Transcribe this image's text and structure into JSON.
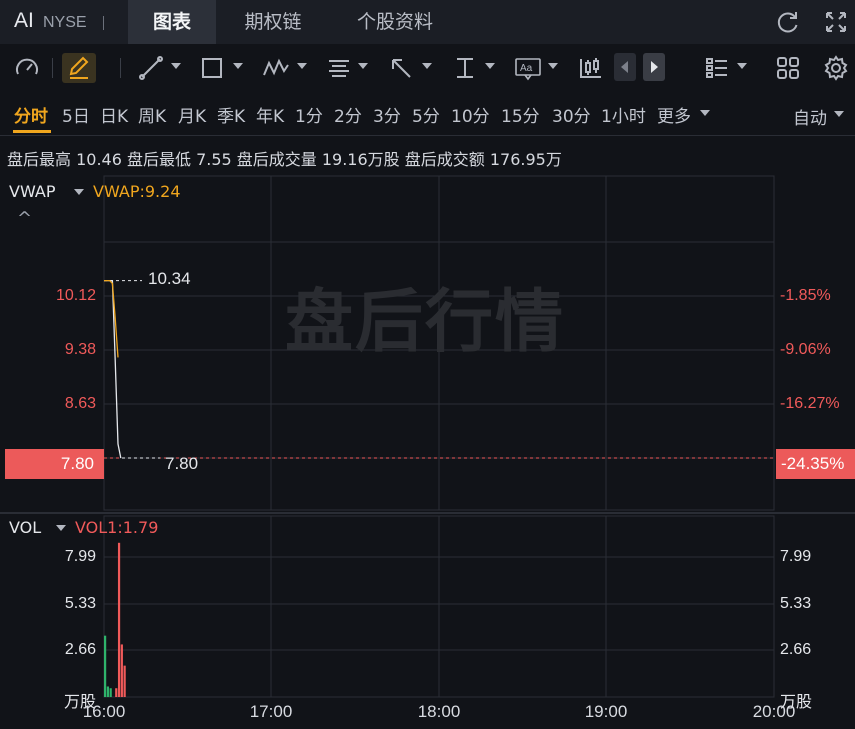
{
  "header": {
    "symbol": "AI",
    "exchange": "NYSE",
    "tabs": [
      {
        "label": "图表",
        "active": true
      },
      {
        "label": "期权链",
        "active": false
      },
      {
        "label": "个股资料",
        "active": false
      }
    ],
    "icons": [
      "refresh-icon",
      "fullscreen-icon"
    ]
  },
  "toolbar": {
    "icons": [
      "gauge-icon",
      "pencil-icon",
      "line-tool-icon",
      "rectangle-tool-icon",
      "wave-tool-icon",
      "text-align-tool-icon",
      "arrow-tool-icon",
      "vertical-measure-icon",
      "text-box-icon",
      "candlestick-icon",
      "prev-icon",
      "next-icon",
      "list-layout-icon",
      "grid-layout-icon",
      "settings-icon"
    ]
  },
  "periods": {
    "items": [
      "分时",
      "5日",
      "日K",
      "周K",
      "月K",
      "季K",
      "年K",
      "1分",
      "2分",
      "3分",
      "5分",
      "10分",
      "15分",
      "30分",
      "1小时",
      "更多"
    ],
    "active": "分时",
    "scale_mode": "自动"
  },
  "stats": {
    "text": "盘后最高 10.46 盘后最低 7.55 盘后成交量 19.16万股 盘后成交额 176.95万"
  },
  "main_panel": {
    "indicator": "VWAP",
    "indicator_value": "VWAP:9.24",
    "collapse_glyph": "^",
    "watermark": "盘后行情",
    "price_labels": [
      "10.12",
      "9.38",
      "8.63"
    ],
    "pct_labels": [
      "-1.85%",
      "-9.06%",
      "-16.27%"
    ],
    "current_price": "7.80",
    "current_pct": "-24.35%",
    "high_marker": "10.34",
    "low_marker": "7.80"
  },
  "volume_panel": {
    "indicator": "VOL",
    "indicator_value": "VOL1:1.79",
    "left_labels": [
      "7.99",
      "5.33",
      "2.66"
    ],
    "right_labels": [
      "7.99",
      "5.33",
      "2.66"
    ],
    "unit": "万股"
  },
  "x_axis": [
    "16:00",
    "17:00",
    "18:00",
    "19:00",
    "20:00"
  ],
  "colors": {
    "accent": "#f0a61e",
    "down": "#f05a5a",
    "up": "#2fb36b",
    "background": "#111318"
  },
  "chart_data": {
    "type": "line",
    "x_range": [
      "16:00",
      "20:00"
    ],
    "ylim": [
      7.55,
      10.46
    ],
    "series": [
      {
        "name": "",
        "x": [
          "16:00",
          "16:01",
          "16:02",
          "16:03",
          "16:04",
          "16:05",
          "16:06"
        ],
        "values": [
          10.34,
          10.34,
          10.34,
          10.34,
          9.2,
          8.0,
          7.8
        ]
      },
      {
        "name": "VWAP",
        "x": [
          "16:00",
          "16:01",
          "16:02",
          "16:03",
          "16:04",
          "16:05"
        ],
        "values": [
          10.34,
          10.34,
          10.34,
          10.3,
          9.8,
          9.24
        ]
      }
    ],
    "volume": {
      "unit": "万股",
      "ylim": [
        0,
        10.6
      ],
      "bars": [
        {
          "x": "16:00",
          "value": 3.5,
          "color": "up"
        },
        {
          "x": "16:01",
          "value": 0.6,
          "color": "up"
        },
        {
          "x": "16:02",
          "value": 0.5,
          "color": "up"
        },
        {
          "x": "16:04",
          "value": 0.5,
          "color": "down"
        },
        {
          "x": "16:05",
          "value": 8.8,
          "color": "down"
        },
        {
          "x": "16:06",
          "value": 3.0,
          "color": "down"
        },
        {
          "x": "16:07",
          "value": 1.79,
          "color": "down"
        }
      ]
    }
  }
}
